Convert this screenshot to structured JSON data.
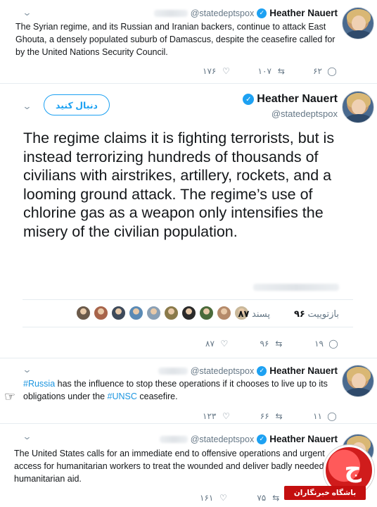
{
  "tweets": [
    {
      "author_name": "Heather Nauert",
      "handle": "@statedeptspox",
      "text": "The Syrian regime, and its Russian and Iranian backers, continue to attack East Ghouta, a densely populated suburb of Damascus, despite the ceasefire called for by the United Nations Security Council.",
      "replies": "۶۲",
      "retweets": "۱۰۷",
      "likes": "۱۷۶"
    },
    {
      "author_name": "Heather Nauert",
      "handle": "@statedeptspox",
      "follow_label": "دنبال کنید",
      "text": "The regime claims it is fighting terrorists, but is instead terrorizing hundreds of thousands of civilians with airstrikes, artillery, rockets, and a looming ground attack. The regime’s use of chlorine gas as a weapon only intensifies the misery of the civilian population.",
      "retweet_count": "۹۶",
      "retweet_label": "بازتوییت",
      "like_count": "۸۷",
      "like_label": "پسند",
      "replies": "۱۹",
      "retweets": "۹۶",
      "likes": "۸۷"
    },
    {
      "author_name": "Heather Nauert",
      "handle": "@statedeptspox",
      "text_parts": {
        "hashtag1": "#Russia",
        "mid": " has the influence to stop these operations if it chooses to live up to its obligations under the ",
        "hashtag2": "#UNSC",
        "end": " ceasefire."
      },
      "replies": "۱۱",
      "retweets": "۶۶",
      "likes": "۱۲۳"
    },
    {
      "author_name": "Heather Nauert",
      "handle": "@statedeptspox",
      "text": "The United States calls for an immediate end to offensive operations and urgent access for humanitarian workers to treat the wounded and deliver badly needed humanitarian aid.",
      "retweets": "۷۵",
      "likes": "۱۶۱"
    }
  ],
  "liker_colors": [
    "#6b5a4a",
    "#a8644a",
    "#3e4a5a",
    "#5a8ab5",
    "#8aa0b5",
    "#8a7a4a",
    "#2a2a2a",
    "#4a6a3a",
    "#b58a6a",
    "#c9b89a"
  ],
  "watermark": "باشگاه خبرنگاران",
  "icons": [
    "chevron-down-icon",
    "verified-icon",
    "reply-icon",
    "retweet-icon",
    "like-icon",
    "hand-cursor-icon"
  ]
}
